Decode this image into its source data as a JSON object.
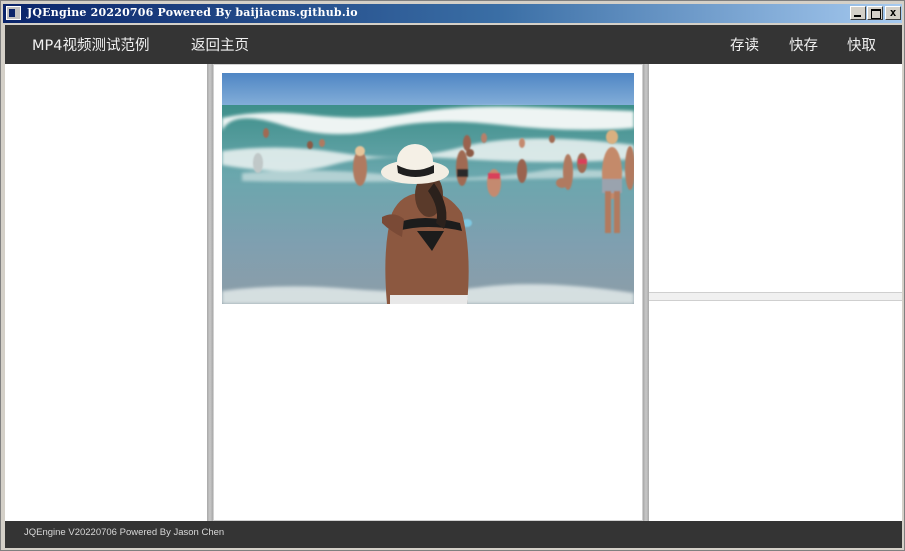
{
  "window": {
    "title": "JQEngine 20220706 Powered By baijiacms.github.io",
    "minimize_label": "",
    "maximize_label": "",
    "close_label": "x"
  },
  "navbar": {
    "title": "MP4视频测试范例",
    "home_label": "返回主页",
    "save_label": "存读",
    "quick_save_label": "快存",
    "quick_load_label": "快取"
  },
  "footer": {
    "text": "JQEngine V20220706 Powered By Jason Chen"
  },
  "colors": {
    "navbar_bg": "#343434",
    "nav_text": "#f0f0f0",
    "title_gradient_start": "#0a246a",
    "title_gradient_end": "#a6caf0"
  },
  "icons": {
    "app": "app-window-icon",
    "minimize": "minimize-icon",
    "maximize": "maximize-icon",
    "close": "close-icon"
  }
}
